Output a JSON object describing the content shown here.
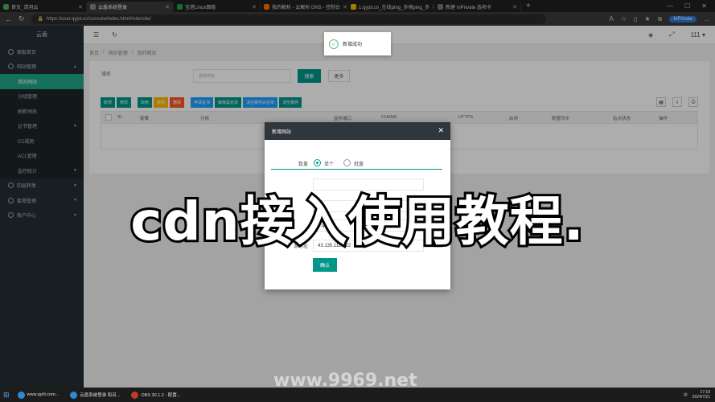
{
  "browser": {
    "tabs": [
      {
        "label": "首页_清羽云",
        "color": "#4caf50"
      },
      {
        "label": "云盾系统登录",
        "color": "#888888",
        "active": true
      },
      {
        "label": "宝塔Linux面板",
        "color": "#20a53a"
      },
      {
        "label": "我的解析 - 云解析 DNS - 控制台",
        "color": "#ff6a00"
      },
      {
        "label": "1.qyjst.cn_在线ping_多地ping_多",
        "color": "#f7b500"
      },
      {
        "label": "新建 InPrivate 选项卡",
        "color": "#777777"
      }
    ],
    "url": "https://user.qyjst.cn/console/index.html#/site/site/",
    "inprivate": "InPrivate"
  },
  "sidebar": {
    "logo": "云盾",
    "items": [
      {
        "label": "面板首页",
        "type": "item"
      },
      {
        "label": "网站管理",
        "type": "item",
        "expanded": true
      },
      {
        "label": "我的网站",
        "type": "sub",
        "active": true
      },
      {
        "label": "分组管理",
        "type": "sub"
      },
      {
        "label": "刷新预热",
        "type": "sub"
      },
      {
        "label": "证书管理",
        "type": "sub",
        "arrow": true
      },
      {
        "label": "CC规则",
        "type": "sub"
      },
      {
        "label": "ACL管理",
        "type": "sub"
      },
      {
        "label": "监控统计",
        "type": "sub",
        "arrow": true
      },
      {
        "label": "四层转发",
        "type": "item",
        "arrow": true
      },
      {
        "label": "套餐管理",
        "type": "item",
        "arrow": true
      },
      {
        "label": "账户中心",
        "type": "item",
        "arrow": true
      }
    ]
  },
  "topbar": {
    "user": "111"
  },
  "breadcrumb": [
    "首页",
    "网站管理",
    "我的网站"
  ],
  "search": {
    "label": "域名",
    "placeholder": "模糊搜索",
    "search_btn": "搜索",
    "more_btn": "更多"
  },
  "toolbar": [
    {
      "label": "新增",
      "color": "teal"
    },
    {
      "label": "修改",
      "color": "teal"
    },
    {
      "label": "启用",
      "color": "teal",
      "gap": true
    },
    {
      "label": "禁用",
      "color": "orange"
    },
    {
      "label": "删除",
      "color": "red"
    },
    {
      "label": "申请证书",
      "color": "blue",
      "gap": true
    },
    {
      "label": "解锁黑名单",
      "color": "teal"
    },
    {
      "label": "清空缓存白名单",
      "color": "blue"
    },
    {
      "label": "清空缓存",
      "color": "teal"
    }
  ],
  "table_headers": [
    "ID",
    "套餐",
    "分组",
    "监听端口",
    "CNAME",
    "HTTPS",
    "启用",
    "配置同步",
    "站点状态",
    "操作"
  ],
  "toast": "新增成功",
  "modal": {
    "title": "新增网站",
    "count_label": "数量",
    "opt_single": "单个",
    "opt_batch": "批量",
    "field1": "",
    "field2": "1.q",
    "source_label": "源地址",
    "source_value": "43.135.118.222",
    "confirm": "确认"
  },
  "overlay_title": "cdn接入使用教程.",
  "watermark": "www.9969.net",
  "taskbar": {
    "tasks": [
      {
        "label": "www.qyhl.com...",
        "color": "#2a8bd6"
      },
      {
        "label": "云盾系统登录 和另...",
        "color": "#2a8bd6"
      },
      {
        "label": "OBS 30.1.2 - 配置...",
        "color": "#c0392b"
      }
    ],
    "time": "17:18",
    "date": "2024/7/21",
    "lang": "中"
  }
}
